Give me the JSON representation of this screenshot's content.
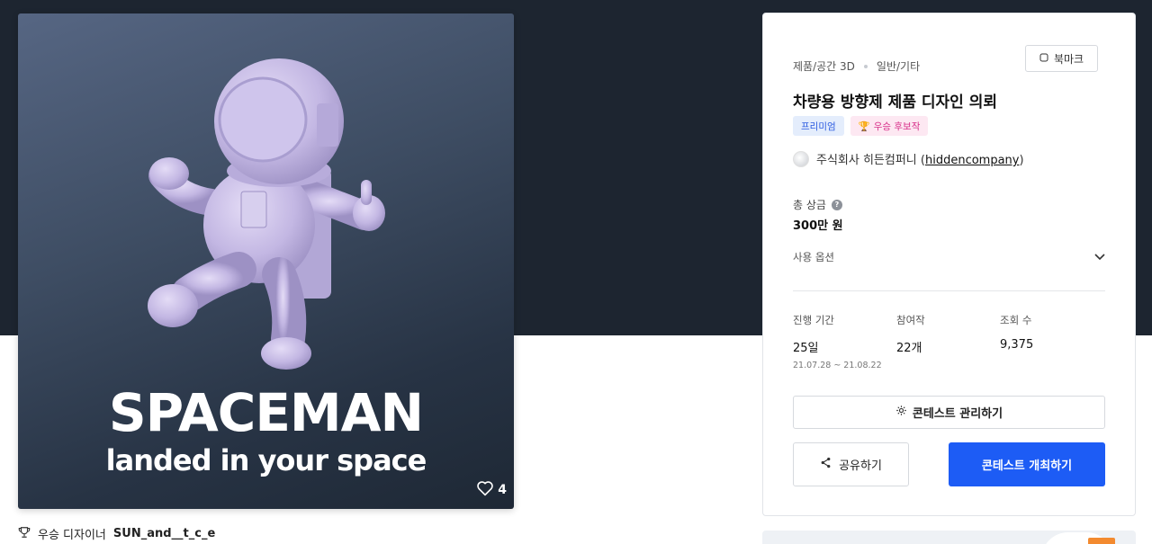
{
  "hero": {
    "image_title": "SPACEMAN",
    "image_subtitle": "landed in your space",
    "like_count": "4"
  },
  "designer": {
    "prefix": "우승 디자이너",
    "name": "SUN_and__t_c_e"
  },
  "panel": {
    "category_main": "제품/공간 3D",
    "category_sub": "일반/기타",
    "bookmark_label": "북마크",
    "title": "차량용 방향제 제품 디자인 의뢰",
    "badges": {
      "premium": "프리미엄",
      "winner": "우승 후보작"
    },
    "company_name": "주식회사 히든컴퍼니 (",
    "company_handle": "hiddencompany",
    "company_close": ")",
    "prize_label": "총 상금",
    "prize_value": "300만 원",
    "usage_label": "사용 옵션",
    "stats": {
      "duration_label": "진행 기간",
      "duration_value": "25일",
      "duration_range": "21.07.28 ~ 21.08.22",
      "participants_label": "참여작",
      "participants_value": "22개",
      "views_label": "조회 수",
      "views_value": "9,375"
    },
    "manage_label": "콘테스트 관리하기",
    "share_label": "공유하기",
    "host_label": "콘테스트 개최하기"
  },
  "colors": {
    "hero_bg": "#1d2530",
    "primary": "#1d5cf5",
    "premium_badge": "#2b5ae0",
    "winner_badge": "#d8308a"
  }
}
